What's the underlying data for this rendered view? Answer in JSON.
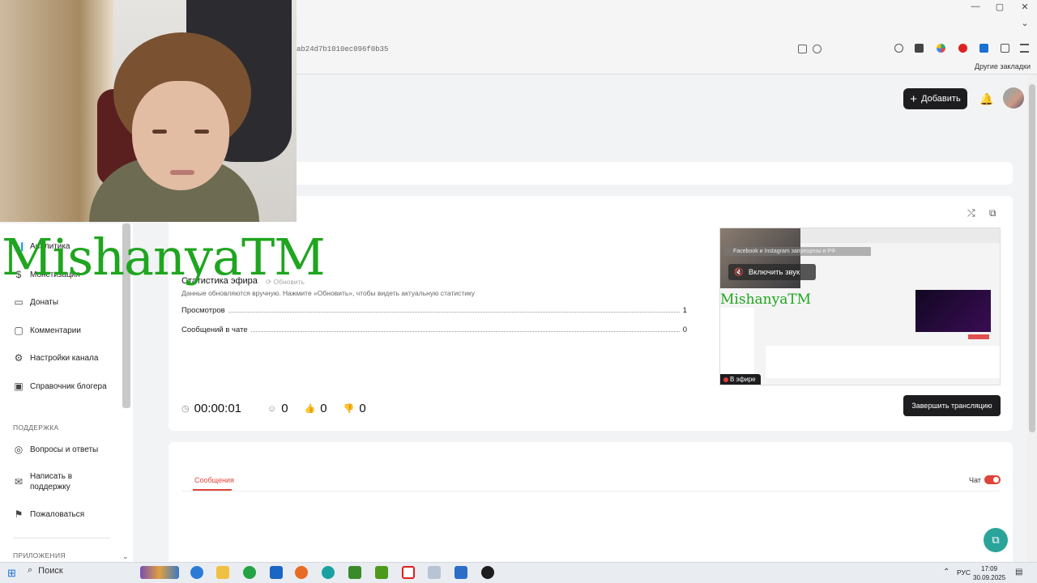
{
  "browser": {
    "url_fragment": "ab24d7b1010ec096f0b35",
    "other_bookmarks": "Другие закладки",
    "window_controls": [
      "—",
      "▢",
      "✕"
    ],
    "dropdown_glyph": "⌄"
  },
  "header": {
    "add_button_label": "Добавить",
    "add_glyph": "+",
    "bell_glyph": "🔔"
  },
  "sidebar": {
    "items": [
      {
        "label": "Аналитика",
        "icon": "chart-icon",
        "glyph": "📊"
      },
      {
        "label": "Монетизация",
        "icon": "coin-icon",
        "glyph": "$"
      },
      {
        "label": "Донаты",
        "icon": "donate-icon",
        "glyph": "▭"
      },
      {
        "label": "Комментарии",
        "icon": "comment-icon",
        "glyph": "▢"
      },
      {
        "label": "Настройки канала",
        "icon": "gear-icon",
        "glyph": "⚙"
      },
      {
        "label": "Справочник блогера",
        "icon": "book-icon",
        "glyph": "▣"
      }
    ],
    "support_title": "ПОДДЕРЖКА",
    "support_items": [
      {
        "label": "Вопросы и ответы",
        "icon": "question-icon",
        "glyph": "◎"
      },
      {
        "label": "Написать в поддержку",
        "icon": "mail-icon",
        "glyph": "✉"
      },
      {
        "label": "Пожаловаться",
        "icon": "flag-icon",
        "glyph": "⚑"
      }
    ],
    "apps_title": "ПРИЛОЖЕНИЯ",
    "chevron_glyph": "⌄"
  },
  "watermark": "MishanyaTM",
  "stats": {
    "title": "Статистика эфира",
    "refresh_label": "⟳ Обновить",
    "hint": "Данные обновляются вручную. Нажмите «Обновить», чтобы видеть актуальную статистику",
    "rows": [
      {
        "label": "Просмотров",
        "value": "1"
      },
      {
        "label": "Сообщений в чате",
        "value": "0"
      }
    ]
  },
  "metrics": {
    "duration": "00:00:01",
    "viewers": "0",
    "likes": "0",
    "dislikes": "0",
    "glyphs": {
      "clock": "◷",
      "viewer": "☺",
      "like": "👍",
      "dislike": "👎"
    }
  },
  "card_glyphs": {
    "share": "⤭",
    "external": "⧉"
  },
  "preview": {
    "banner": "Facebook и Instagram запрещены в РФ",
    "sound_label": "Включить звук",
    "sound_glyph": "🔇",
    "watermark": "MishanyaTM",
    "live_label": "В эфире"
  },
  "end_stream_label": "Завершить трансляцию",
  "chat": {
    "tab_label": "Сообщения",
    "toggle_label": "Чат",
    "toggle_on": true,
    "help_glyph": "⧉"
  },
  "taskbar": {
    "start_glyph": "⊞",
    "search_glyph": "⌕",
    "search_label": "Поиск",
    "lang": "РУС",
    "time": "17:09",
    "date": "30.09.2025",
    "tray_glyph": "⌃",
    "notify_glyph": "▤"
  },
  "colors": {
    "accent": "#e0443a",
    "dark": "#1d1d1f",
    "watermark": "#1fa51f",
    "fab": "#2aa39b"
  }
}
